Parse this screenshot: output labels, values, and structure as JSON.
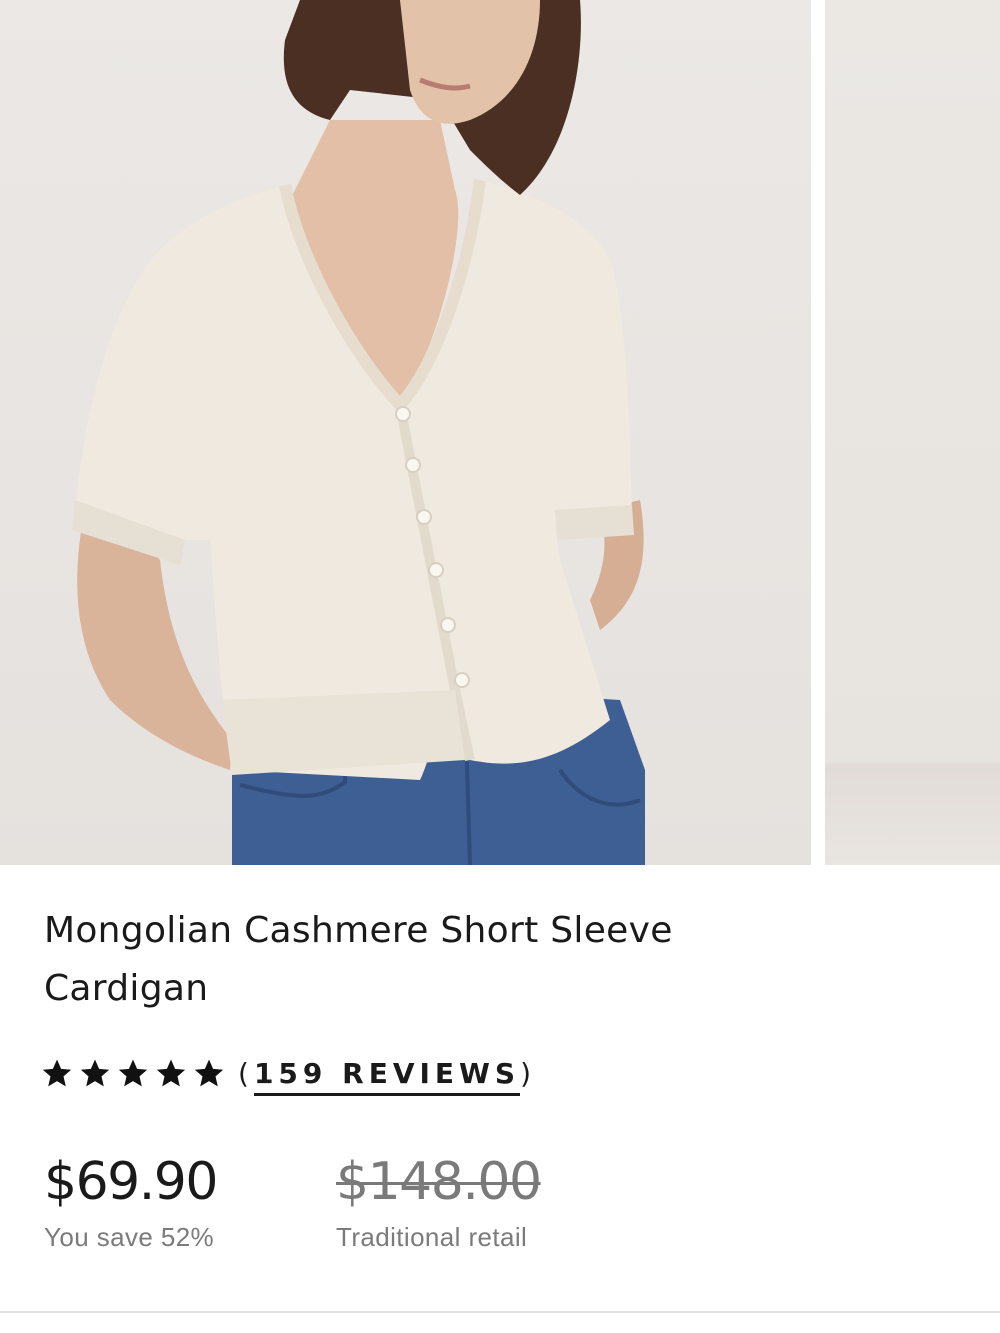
{
  "gallery": {
    "main_image_alt": "Model wearing cream short sleeve cardigan with jeans",
    "next_image_alt": "Next product image"
  },
  "product": {
    "title": "Mongolian Cashmere Short Sleeve Cardigan",
    "rating": {
      "stars_filled": 5,
      "stars_total": 5,
      "open_paren": "(",
      "reviews_label": "159 REVIEWS",
      "close_paren": ")"
    },
    "price": {
      "current": "$69.90",
      "savings": "You save 52%",
      "original": "$148.00",
      "original_label": "Traditional retail"
    }
  },
  "colors": {
    "text": "#1a1a1a",
    "muted": "#7b7b7b",
    "sweater": "#efe9df",
    "denim": "#3e5f93"
  },
  "icons": {
    "star": "star-icon"
  }
}
